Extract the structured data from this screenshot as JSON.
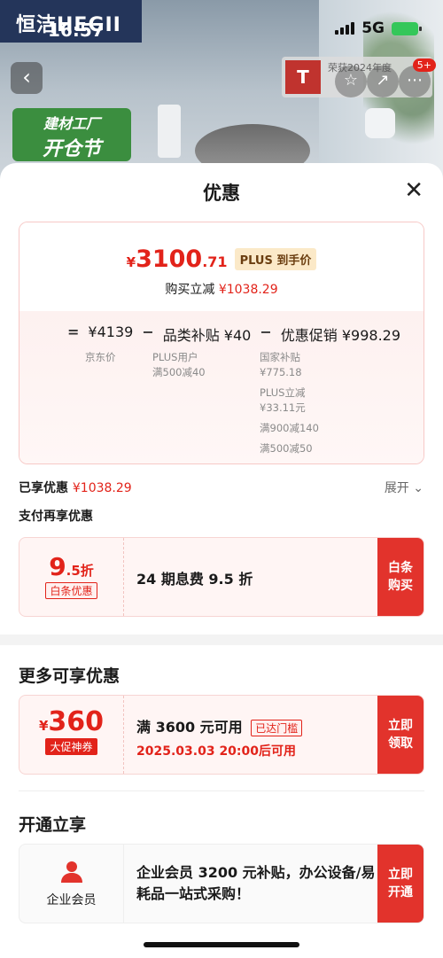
{
  "status": {
    "time": "16:57",
    "network": "5G"
  },
  "background": {
    "brand_logo": "恒洁HEGII",
    "award_text": "荣获2024年度",
    "award_badge": "T",
    "cart_count": "5+",
    "promo_line1": "建材工厂",
    "promo_line2": "开仓节"
  },
  "sheet": {
    "title": "优惠",
    "close": "✕"
  },
  "price_card": {
    "yen": "¥",
    "price_int": "3100",
    "price_dec": ".71",
    "plus_badge": "PLUS 到手价",
    "reduce_label": "购买立减",
    "reduce_amount": "¥1038.29",
    "formula": {
      "eq": "=",
      "original": "¥4139",
      "minus1": "−",
      "category_subsidy": "品类补贴 ¥40",
      "minus2": "−",
      "promo_total": "优惠促销 ¥998.29"
    },
    "original_label": "京东价",
    "subsidy_detail": [
      "PLUS用户",
      "满500减40"
    ],
    "promo_detail": [
      "国家补贴",
      "¥775.18",
      "PLUS立减",
      "¥33.11元",
      "满900减140",
      "满500减50"
    ]
  },
  "enjoyed": {
    "label": "已享优惠",
    "amount": "¥1038.29",
    "expand": "展开"
  },
  "pay_section": {
    "title": "支付再享优惠",
    "coupon": {
      "big": "9",
      "small": ".5折",
      "tag": "白条优惠",
      "desc": "24 期息费 9.5 折",
      "action": [
        "白条",
        "购买"
      ]
    }
  },
  "more_section": {
    "title": "更多可享优惠",
    "coupon": {
      "yen": "¥",
      "amount": "360",
      "tag": "大促神券",
      "desc": "满 3600 元可用",
      "status": "已达门槛",
      "time": "2025.03.03 20:00后可用",
      "action": [
        "立即",
        "领取"
      ]
    }
  },
  "open_section": {
    "title": "开通立享",
    "card": {
      "label": "企业会员",
      "desc": "企业会员 3200 元补贴，办公设备/易耗品一站式采购！",
      "action": [
        "立即",
        "开通"
      ]
    }
  },
  "colors": {
    "accent": "#e2231a",
    "action_bg": "#e2332c",
    "plus_bg": "#fbe9c8"
  }
}
